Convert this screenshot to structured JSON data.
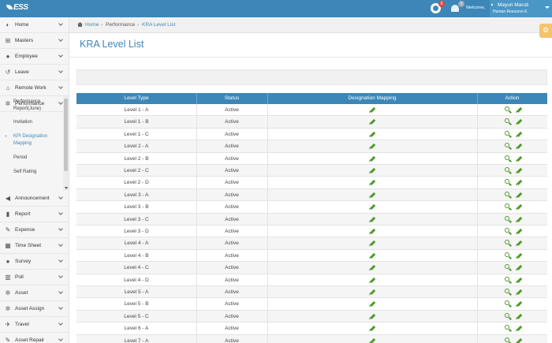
{
  "header": {
    "logo_text": "ESS",
    "notifications_count": "8",
    "messages_count": "0",
    "welcome_text": "Welcome,",
    "user_name": "Mayuri Maruti",
    "user_role": "Human Resource E",
    "accent_color": "#3c87b8"
  },
  "sidebar": {
    "items_top": [
      {
        "label": "Home",
        "icon": "palette-icon"
      },
      {
        "label": "Masters",
        "icon": "sitemap-icon"
      },
      {
        "label": "Employee",
        "icon": "user-icon"
      },
      {
        "label": "Leave",
        "icon": "history-icon"
      },
      {
        "label": "Remote Work",
        "icon": "home-icon"
      },
      {
        "label": "Performance",
        "icon": "gear-icon"
      }
    ],
    "sub_items": [
      {
        "label": "Performance Report(June)",
        "active": false
      },
      {
        "label": "Invitation",
        "active": false
      },
      {
        "label": "KPI Designation Mapping",
        "active": true
      },
      {
        "label": "Period",
        "active": false
      },
      {
        "label": "Self Rating",
        "active": false
      }
    ],
    "items_bottom": [
      {
        "label": "Announcement",
        "icon": "bullhorn-icon"
      },
      {
        "label": "Report",
        "icon": "book-icon"
      },
      {
        "label": "Expense",
        "icon": "pencil-icon"
      },
      {
        "label": "Time Sheet",
        "icon": "calendar-icon"
      },
      {
        "label": "Survey",
        "icon": "users-icon"
      },
      {
        "label": "Poll",
        "icon": "bar-chart-icon"
      },
      {
        "label": "Asset",
        "icon": "cogs-icon"
      },
      {
        "label": "Asset Assign",
        "icon": "cogs-icon"
      },
      {
        "label": "Travel",
        "icon": "plane-icon"
      },
      {
        "label": "Asset Repair",
        "icon": "wrench-icon"
      }
    ]
  },
  "breadcrumb": {
    "home": "Home",
    "separator": "›",
    "performance": "Performance",
    "current": "KRA Level List"
  },
  "page": {
    "title": "KRA Level List"
  },
  "table": {
    "columns": [
      "Level Type",
      "Status",
      "Designation Mapping",
      "Action"
    ],
    "rows": [
      {
        "level": "Level 1 - A",
        "status": "Active"
      },
      {
        "level": "Level 1 - B",
        "status": "Active"
      },
      {
        "level": "Level 1 - C",
        "status": "Active"
      },
      {
        "level": "Level 2 - A",
        "status": "Active"
      },
      {
        "level": "Level 2 - B",
        "status": "Active"
      },
      {
        "level": "Level 2 - C",
        "status": "Active"
      },
      {
        "level": "Level 2 - D",
        "status": "Active"
      },
      {
        "level": "Level 3 - A",
        "status": "Active"
      },
      {
        "level": "Level 3 - B",
        "status": "Active"
      },
      {
        "level": "Level 3 - C",
        "status": "Active"
      },
      {
        "level": "Level 3 - D",
        "status": "Active"
      },
      {
        "level": "Level 4 - A",
        "status": "Active"
      },
      {
        "level": "Level 4 - B",
        "status": "Active"
      },
      {
        "level": "Level 4 - C",
        "status": "Active"
      },
      {
        "level": "Level 4 - D",
        "status": "Active"
      },
      {
        "level": "Level 5 - A",
        "status": "Active"
      },
      {
        "level": "Level 5 - B",
        "status": "Active"
      },
      {
        "level": "Level 5 - C",
        "status": "Active"
      },
      {
        "level": "Level 6 - A",
        "status": "Active"
      },
      {
        "level": "Level 7 - A",
        "status": "Active"
      }
    ]
  }
}
